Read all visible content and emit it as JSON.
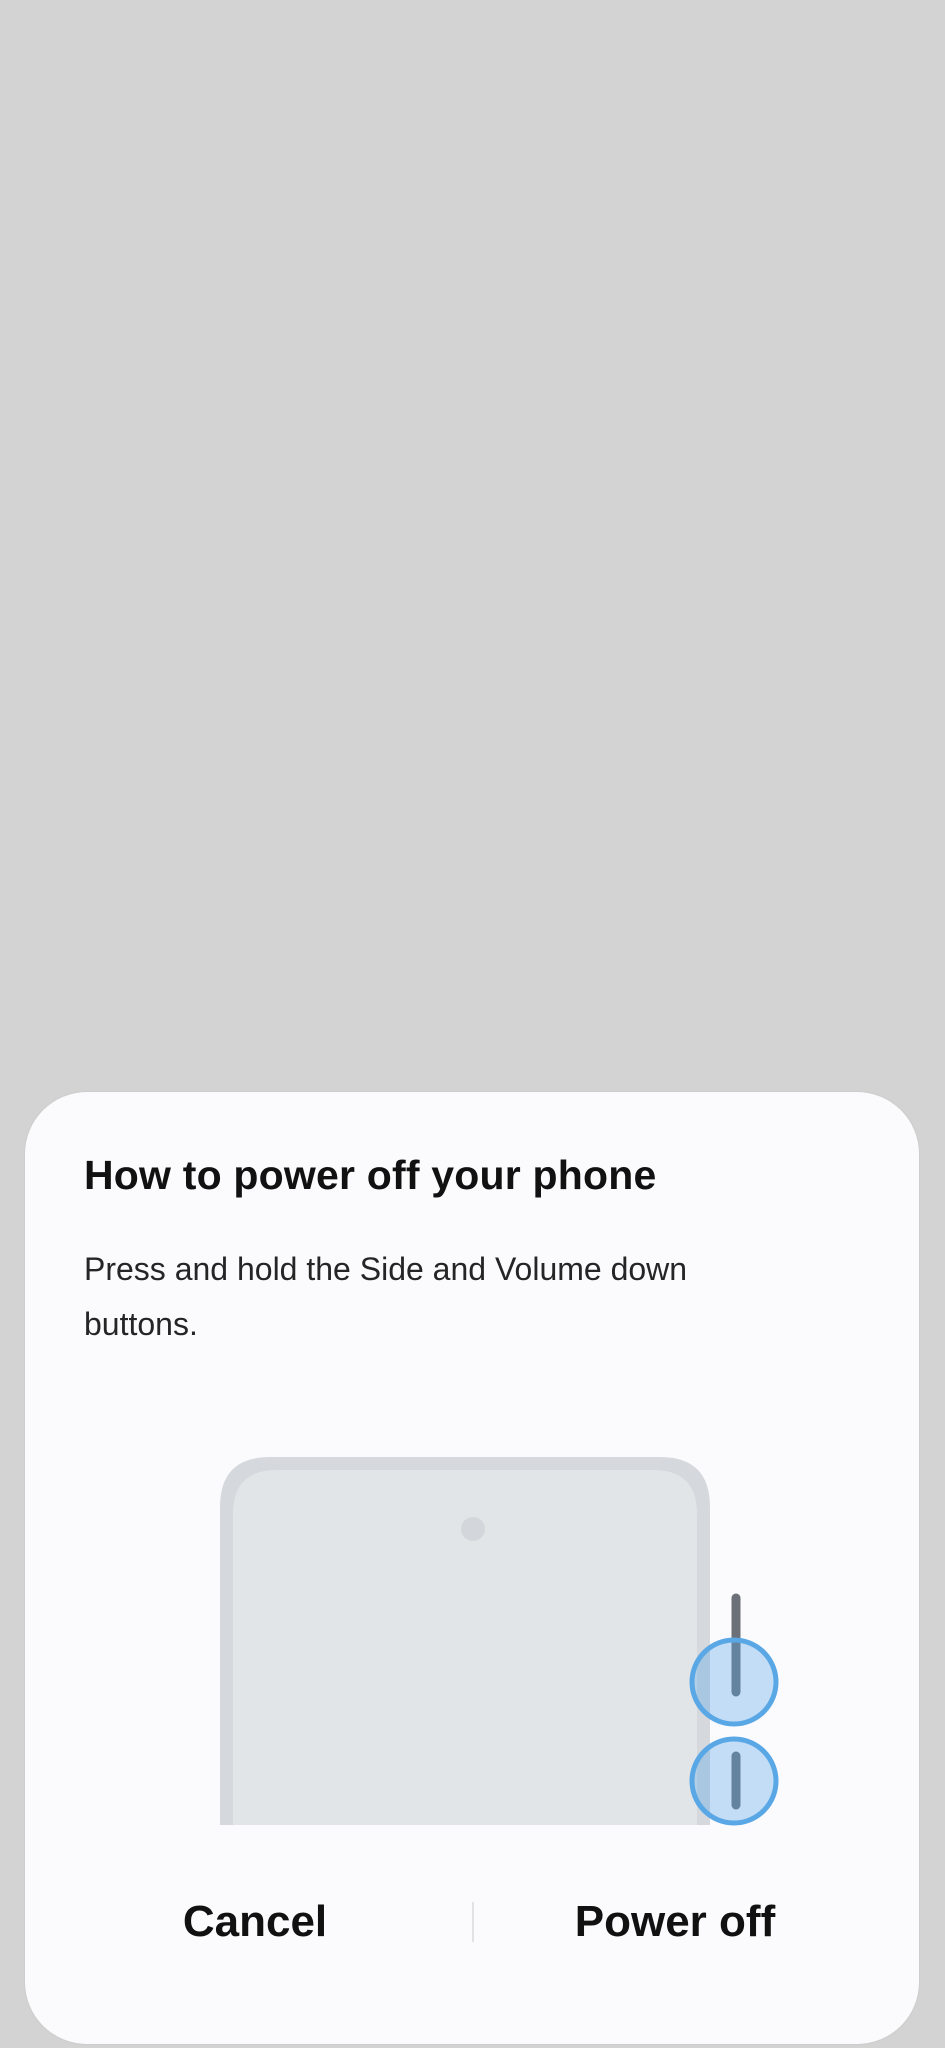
{
  "dialog": {
    "title": "How to power off your phone",
    "message": "Press and hold the Side and Volume down buttons.",
    "cancel_label": "Cancel",
    "power_off_label": "Power off"
  },
  "illustration": {
    "icon": "phone-side-buttons-illustration",
    "phone_color": "#e2e5e8",
    "phone_frame_color": "#d5d9de",
    "highlight_color": "#5aa7e6"
  },
  "colors": {
    "backdrop": "#d3d3d3",
    "dialog_bg": "#fbfbfd",
    "text": "#111111"
  }
}
